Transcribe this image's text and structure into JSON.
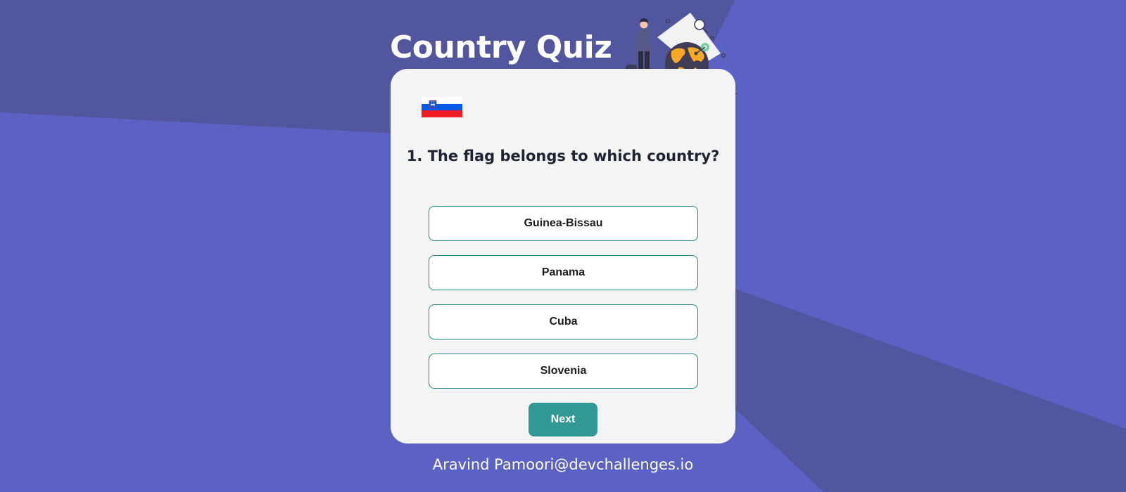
{
  "page": {
    "title": "Country Quiz",
    "footer_text": "Aravind Pamoori@devchallenges.io"
  },
  "colors": {
    "background": "#5c62c4",
    "background_dark": "#52569f",
    "card": "#f4f4f4",
    "option_border": "#1e8c84",
    "next_button": "#329894",
    "question_text": "#1d2235"
  },
  "hero": {
    "icon": "traveler-with-globe-illustration"
  },
  "quiz": {
    "flag": {
      "icon": "slovenia-flag"
    },
    "question": "1. The flag belongs to which country?",
    "options": [
      {
        "label": "Guinea-Bissau"
      },
      {
        "label": "Panama"
      },
      {
        "label": "Cuba"
      },
      {
        "label": "Slovenia"
      }
    ],
    "next_label": "Next"
  }
}
